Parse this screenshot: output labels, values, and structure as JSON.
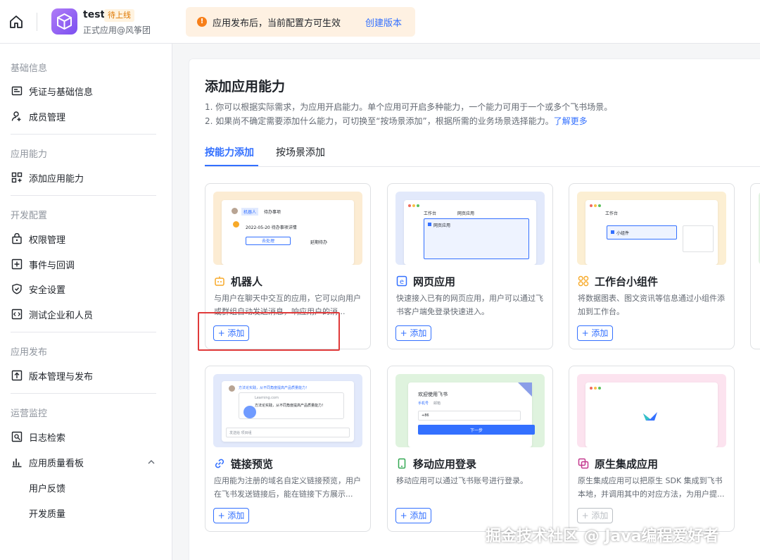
{
  "header": {
    "app_name": "test",
    "app_status": "待上线",
    "app_subtitle": "正式应用@风筝团",
    "notice_text": "应用发布后，当前配置方可生效",
    "notice_link": "创建版本"
  },
  "sidebar": {
    "sections": [
      {
        "title": "基础信息",
        "items": [
          "凭证与基础信息",
          "成员管理"
        ]
      },
      {
        "title": "应用能力",
        "items": [
          "添加应用能力"
        ]
      },
      {
        "title": "开发配置",
        "items": [
          "权限管理",
          "事件与回调",
          "安全设置",
          "测试企业和人员"
        ]
      },
      {
        "title": "应用发布",
        "items": [
          "版本管理与发布"
        ]
      },
      {
        "title": "运营监控",
        "items": [
          "日志检索",
          "应用质量看板"
        ],
        "subitems": [
          "用户反馈",
          "开发质量"
        ]
      }
    ]
  },
  "main": {
    "title": "添加应用能力",
    "desc_line1": "1. 你可以根据实际需求，为应用开启能力。单个应用可开启多种能力，一个能力可用于一个或多个飞书场景。",
    "desc_line2": "2. 如果尚不确定需要添加什么能力，可切换至“按场景添加”，根据所需的业务场景选择能力。",
    "desc_link": "了解更多",
    "tabs": [
      "按能力添加",
      "按场景添加"
    ],
    "add_label": "+ 添加",
    "cards": [
      {
        "title": "机器人",
        "desc": "与用户在聊天中交互的应用，它可以向用户或群组自动发送消息，响应用户的消...",
        "icon": "robot-icon",
        "cover_color": "#fcecd3"
      },
      {
        "title": "网页应用",
        "desc": "快速接入已有的网页应用，用户可以通过飞书客户端免登录快速进入。",
        "icon": "web-app-icon",
        "cover_color": "#e2e9fb"
      },
      {
        "title": "工作台小组件",
        "desc": "将数据图表、图文资讯等信息通过小组件添加到工作台。",
        "icon": "widget-icon",
        "cover_color": "#fcefd3"
      },
      {
        "title": "链接预览",
        "desc": "应用能为注册的域名自定义链接预览，用户在飞书发送链接后，能在链接下方展示...",
        "icon": "link-icon",
        "cover_color": "#e2e9fb"
      },
      {
        "title": "移动应用登录",
        "desc": "移动应用可以通过飞书账号进行登录。",
        "icon": "mobile-icon",
        "cover_color": "#dff3de"
      },
      {
        "title": "原生集成应用",
        "desc": "原生集成应用可以把原生 SDK 集成到飞书本地，并调用其中的对应方法，为用户提...",
        "icon": "native-app-icon",
        "cover_color": "#fce3ef"
      }
    ],
    "mock": {
      "bot_tag": "机器人",
      "bot_todo": "待办事项",
      "bot_date": "2022-05-20 待办事项详情",
      "bot_btn1": "去处理",
      "bot_btn2": "延期待办",
      "web_tab1": "工作台",
      "web_tab2": "网页应用",
      "web_app": "网页应用",
      "widget_tab": "工作台",
      "widget_name": "小组件",
      "link_msg": "方法论实践，从不同角度提高产品质量能力！",
      "link_site": "Learning.com",
      "link_title": "方法论实践，从不同角度提高产品质量能力！",
      "link_input": "发送给 项目组",
      "login_welcome": "欢迎使用飞书",
      "login_tab1": "手机号",
      "login_tab2": "邮箱",
      "login_code": "+86",
      "login_next": "下一步"
    }
  },
  "watermark": "掘金技术社区 @ Java编程爱好者"
}
